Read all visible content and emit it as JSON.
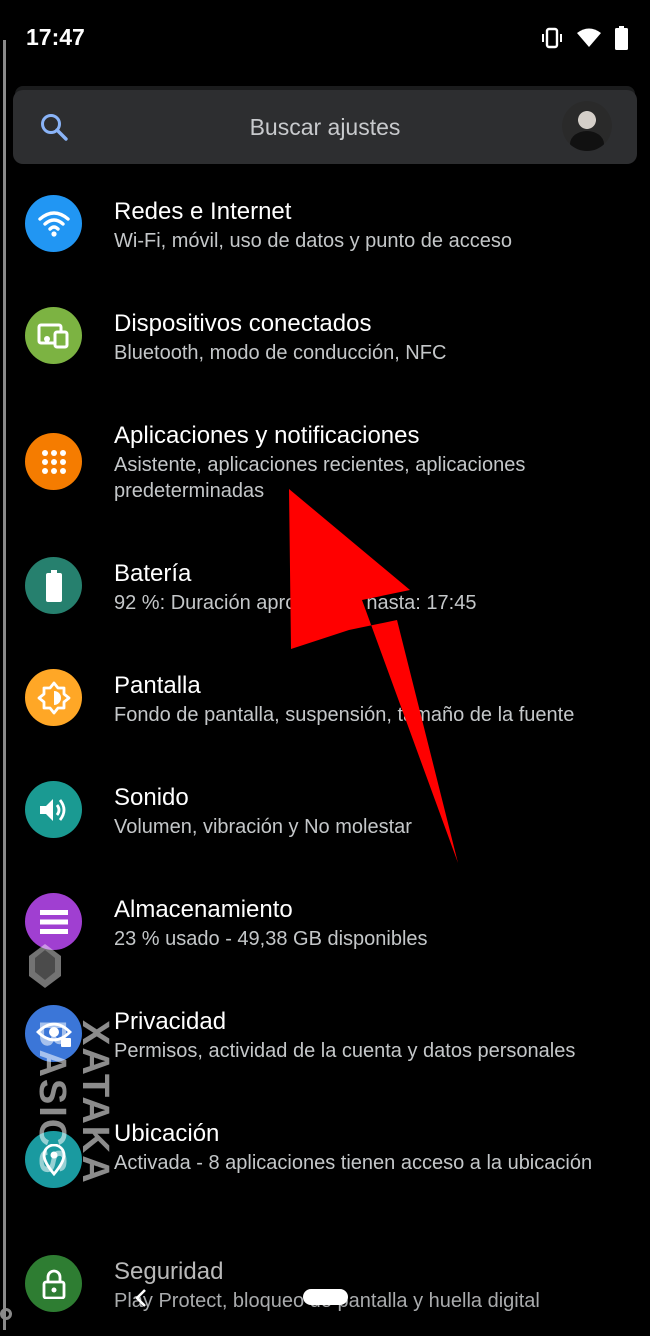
{
  "status_bar": {
    "time": "17:47",
    "icons": [
      "vibrate-icon",
      "wifi-icon",
      "battery-icon"
    ]
  },
  "search": {
    "placeholder": "Buscar ajustes",
    "icon": "search-icon",
    "avatar": "user-avatar"
  },
  "settings": [
    {
      "title": "Redes e Internet",
      "subtitle": "Wi-Fi, móvil, uso de datos y punto de acceso",
      "icon": "wifi-icon",
      "color": "#2196f3"
    },
    {
      "title": "Dispositivos conectados",
      "subtitle": "Bluetooth, modo de conducción, NFC",
      "icon": "devices-icon",
      "color": "#7cb342"
    },
    {
      "title": "Aplicaciones y notificaciones",
      "subtitle": "Asistente, aplicaciones recientes, aplicaciones predeterminadas",
      "icon": "apps-grid-icon",
      "color": "#f57c00"
    },
    {
      "title": "Batería",
      "subtitle": "92 %: Duración aproximada hasta: 17:45",
      "icon": "battery-icon",
      "color": "#26806e"
    },
    {
      "title": "Pantalla",
      "subtitle": "Fondo de pantalla, suspensión, tamaño de la fuente",
      "icon": "brightness-icon",
      "color": "#ffa726"
    },
    {
      "title": "Sonido",
      "subtitle": "Volumen, vibración y No molestar",
      "icon": "volume-icon",
      "color": "#1a9a92"
    },
    {
      "title": "Almacenamiento",
      "subtitle": "23 % usado - 49,38 GB disponibles",
      "icon": "storage-icon",
      "color": "#a03fd1"
    },
    {
      "title": "Privacidad",
      "subtitle": "Permisos, actividad de la cuenta y datos personales",
      "icon": "privacy-eye-icon",
      "color": "#3b76d8"
    },
    {
      "title": "Ubicación",
      "subtitle": "Activada - 8 aplicaciones tienen acceso a la ubicación",
      "icon": "location-pin-icon",
      "color": "#1a9aa0"
    },
    {
      "title": "Seguridad",
      "subtitle": "Play Protect, bloqueo de pantalla y huella digital",
      "icon": "lock-icon",
      "color": "#2e7d32"
    }
  ],
  "watermark": {
    "text": "XATAKA BASICS"
  },
  "annotation": {
    "arrow_color": "#ff0000"
  },
  "nav": {
    "back": "back-arrow-icon",
    "home": "home-pill"
  }
}
